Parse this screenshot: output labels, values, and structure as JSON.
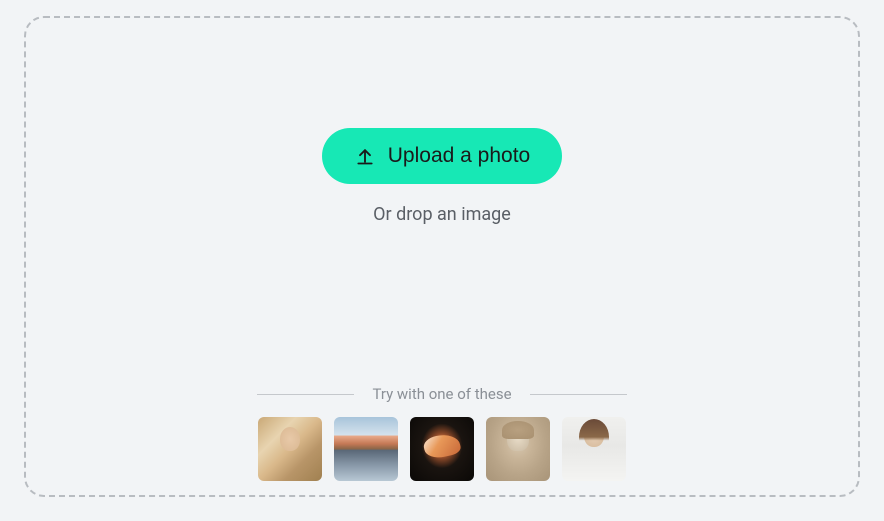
{
  "upload": {
    "button_label": "Upload a photo",
    "drop_text": "Or drop an image"
  },
  "samples": {
    "label": "Try with one of these",
    "items": [
      {
        "name": "woman-portrait-blonde"
      },
      {
        "name": "mountain-landscape"
      },
      {
        "name": "sneaker-product"
      },
      {
        "name": "vintage-portrait-sepia"
      },
      {
        "name": "woman-sunglasses-white"
      }
    ]
  }
}
